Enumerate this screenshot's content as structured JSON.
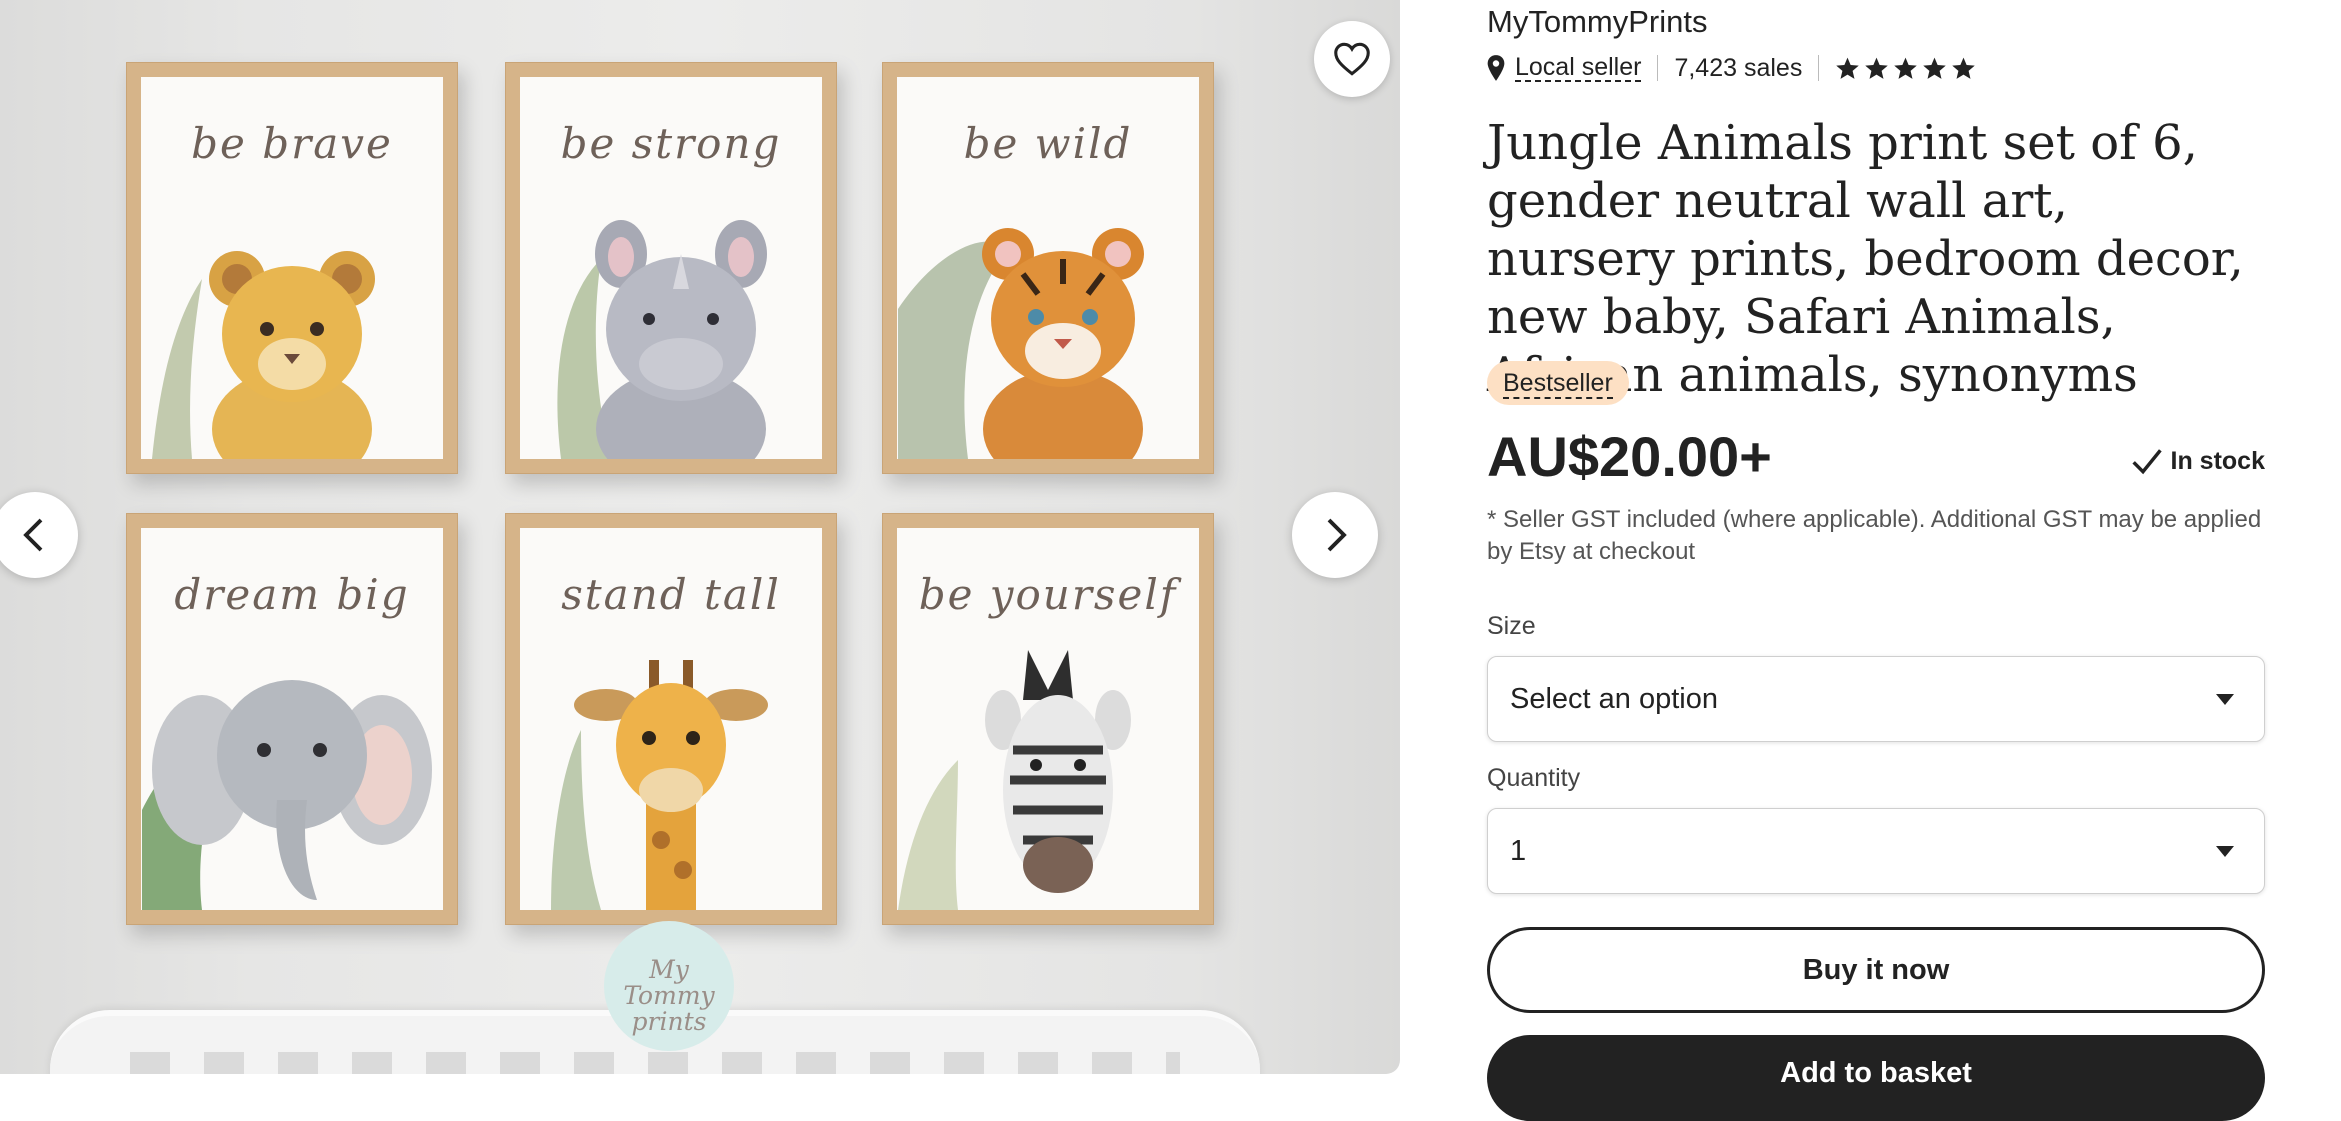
{
  "gallery": {
    "captions": [
      "be brave",
      "be strong",
      "be wild",
      "dream big",
      "stand tall",
      "be yourself"
    ],
    "watermark_line1": "My Tommy",
    "watermark_line2": "prints",
    "icons": {
      "favorite": "heart-icon",
      "prev": "chevron-left-icon",
      "next": "chevron-right-icon"
    }
  },
  "shop": {
    "name": "MyTommyPrints",
    "local_seller_label": "Local seller",
    "sales": "7,423 sales",
    "rating_stars": 5
  },
  "listing": {
    "title": "Jungle Animals print set of 6, gender neutral wall art, nursery prints, bedroom decor, new baby, Safari Animals, African animals, synonyms",
    "badge": "Bestseller",
    "price": "AU$20.00+",
    "stock": "In stock",
    "gst_note": "* Seller GST included (where applicable). Additional GST may be applied by Etsy at checkout"
  },
  "options": {
    "size_label": "Size",
    "size_value": "Select an option",
    "quantity_label": "Quantity",
    "quantity_value": "1"
  },
  "actions": {
    "buy_now": "Buy it now",
    "add_to_basket": "Add to basket"
  },
  "colors": {
    "badge_bg": "#fde0c4",
    "frame": "#d6b489",
    "dark_button": "#222222"
  }
}
